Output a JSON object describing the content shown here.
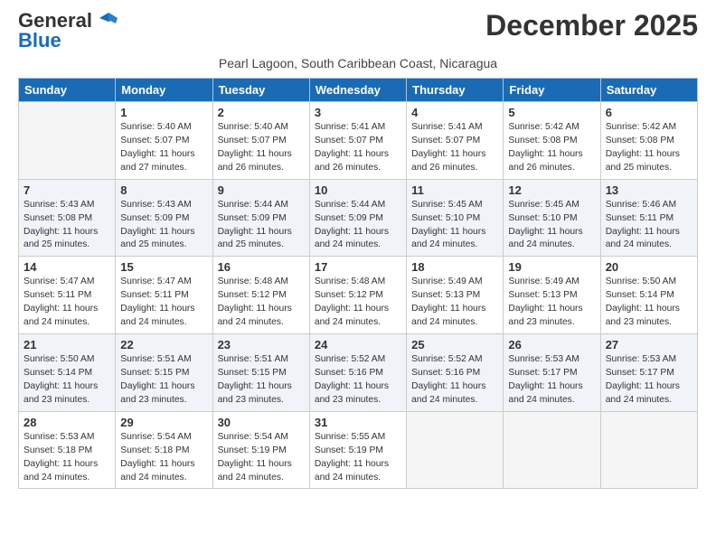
{
  "header": {
    "logo_line1": "General",
    "logo_line2": "Blue",
    "month_title": "December 2025",
    "location": "Pearl Lagoon, South Caribbean Coast, Nicaragua"
  },
  "weekdays": [
    "Sunday",
    "Monday",
    "Tuesday",
    "Wednesday",
    "Thursday",
    "Friday",
    "Saturday"
  ],
  "weeks": [
    [
      {
        "day": "",
        "empty": true
      },
      {
        "day": "1",
        "sunrise": "5:40 AM",
        "sunset": "5:07 PM",
        "daylight": "11 hours and 27 minutes."
      },
      {
        "day": "2",
        "sunrise": "5:40 AM",
        "sunset": "5:07 PM",
        "daylight": "11 hours and 26 minutes."
      },
      {
        "day": "3",
        "sunrise": "5:41 AM",
        "sunset": "5:07 PM",
        "daylight": "11 hours and 26 minutes."
      },
      {
        "day": "4",
        "sunrise": "5:41 AM",
        "sunset": "5:07 PM",
        "daylight": "11 hours and 26 minutes."
      },
      {
        "day": "5",
        "sunrise": "5:42 AM",
        "sunset": "5:08 PM",
        "daylight": "11 hours and 26 minutes."
      },
      {
        "day": "6",
        "sunrise": "5:42 AM",
        "sunset": "5:08 PM",
        "daylight": "11 hours and 25 minutes."
      }
    ],
    [
      {
        "day": "7",
        "sunrise": "5:43 AM",
        "sunset": "5:08 PM",
        "daylight": "11 hours and 25 minutes."
      },
      {
        "day": "8",
        "sunrise": "5:43 AM",
        "sunset": "5:09 PM",
        "daylight": "11 hours and 25 minutes."
      },
      {
        "day": "9",
        "sunrise": "5:44 AM",
        "sunset": "5:09 PM",
        "daylight": "11 hours and 25 minutes."
      },
      {
        "day": "10",
        "sunrise": "5:44 AM",
        "sunset": "5:09 PM",
        "daylight": "11 hours and 24 minutes."
      },
      {
        "day": "11",
        "sunrise": "5:45 AM",
        "sunset": "5:10 PM",
        "daylight": "11 hours and 24 minutes."
      },
      {
        "day": "12",
        "sunrise": "5:45 AM",
        "sunset": "5:10 PM",
        "daylight": "11 hours and 24 minutes."
      },
      {
        "day": "13",
        "sunrise": "5:46 AM",
        "sunset": "5:11 PM",
        "daylight": "11 hours and 24 minutes."
      }
    ],
    [
      {
        "day": "14",
        "sunrise": "5:47 AM",
        "sunset": "5:11 PM",
        "daylight": "11 hours and 24 minutes."
      },
      {
        "day": "15",
        "sunrise": "5:47 AM",
        "sunset": "5:11 PM",
        "daylight": "11 hours and 24 minutes."
      },
      {
        "day": "16",
        "sunrise": "5:48 AM",
        "sunset": "5:12 PM",
        "daylight": "11 hours and 24 minutes."
      },
      {
        "day": "17",
        "sunrise": "5:48 AM",
        "sunset": "5:12 PM",
        "daylight": "11 hours and 24 minutes."
      },
      {
        "day": "18",
        "sunrise": "5:49 AM",
        "sunset": "5:13 PM",
        "daylight": "11 hours and 24 minutes."
      },
      {
        "day": "19",
        "sunrise": "5:49 AM",
        "sunset": "5:13 PM",
        "daylight": "11 hours and 23 minutes."
      },
      {
        "day": "20",
        "sunrise": "5:50 AM",
        "sunset": "5:14 PM",
        "daylight": "11 hours and 23 minutes."
      }
    ],
    [
      {
        "day": "21",
        "sunrise": "5:50 AM",
        "sunset": "5:14 PM",
        "daylight": "11 hours and 23 minutes."
      },
      {
        "day": "22",
        "sunrise": "5:51 AM",
        "sunset": "5:15 PM",
        "daylight": "11 hours and 23 minutes."
      },
      {
        "day": "23",
        "sunrise": "5:51 AM",
        "sunset": "5:15 PM",
        "daylight": "11 hours and 23 minutes."
      },
      {
        "day": "24",
        "sunrise": "5:52 AM",
        "sunset": "5:16 PM",
        "daylight": "11 hours and 23 minutes."
      },
      {
        "day": "25",
        "sunrise": "5:52 AM",
        "sunset": "5:16 PM",
        "daylight": "11 hours and 24 minutes."
      },
      {
        "day": "26",
        "sunrise": "5:53 AM",
        "sunset": "5:17 PM",
        "daylight": "11 hours and 24 minutes."
      },
      {
        "day": "27",
        "sunrise": "5:53 AM",
        "sunset": "5:17 PM",
        "daylight": "11 hours and 24 minutes."
      }
    ],
    [
      {
        "day": "28",
        "sunrise": "5:53 AM",
        "sunset": "5:18 PM",
        "daylight": "11 hours and 24 minutes."
      },
      {
        "day": "29",
        "sunrise": "5:54 AM",
        "sunset": "5:18 PM",
        "daylight": "11 hours and 24 minutes."
      },
      {
        "day": "30",
        "sunrise": "5:54 AM",
        "sunset": "5:19 PM",
        "daylight": "11 hours and 24 minutes."
      },
      {
        "day": "31",
        "sunrise": "5:55 AM",
        "sunset": "5:19 PM",
        "daylight": "11 hours and 24 minutes."
      },
      {
        "day": "",
        "empty": true
      },
      {
        "day": "",
        "empty": true
      },
      {
        "day": "",
        "empty": true
      }
    ]
  ]
}
